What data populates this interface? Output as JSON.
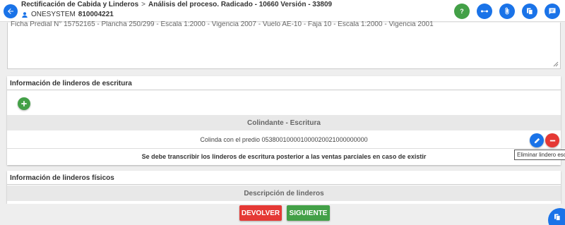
{
  "header": {
    "breadcrumb_1": "Rectificación de Cabida y Linderos",
    "breadcrumb_sep": ">",
    "breadcrumb_2": "Análisis del proceso. Radicado - 10660 Versión - 33809",
    "user_label": "ONESYSTEM",
    "user_id": "810004221",
    "icons": [
      "help-icon",
      "workflow-icon",
      "attachment-icon",
      "copy-icon",
      "comment-icon"
    ]
  },
  "textarea": {
    "value": "Ficha Predial N° 15752165 - Plancha 250/299 - Escala 1:2000 - Vigencia 2007 - Vuelo AE-10 - Faja 10 - Escala 1:2000 - Vigencia 2001"
  },
  "escritura": {
    "title": "Información de linderos de escritura",
    "column_header": "Colindante - Escritura",
    "rows": [
      {
        "value": "Colinda con el predio 053800100001000020021000000000"
      }
    ],
    "note": "Se debe transcribir los linderos de escritura posterior a las ventas parciales en caso de existir",
    "tooltip": "Eliminar lindero escritura"
  },
  "fisicos": {
    "title": "Información de linderos físicos",
    "column_header": "Descripción de linderos"
  },
  "footer": {
    "devolver": "DEVOLVER",
    "siguiente": "SIGUIENTE"
  },
  "colors": {
    "primary": "#1a73e8",
    "success": "#43a047",
    "danger": "#e53935"
  }
}
